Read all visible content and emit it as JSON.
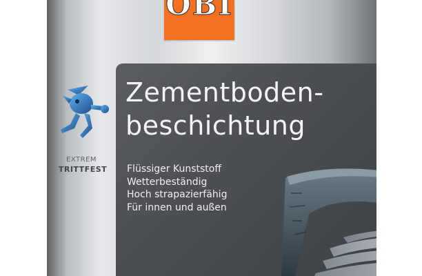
{
  "brand": {
    "logo_text": "OBI",
    "logo_color": "#f36f21"
  },
  "product": {
    "title_line1": "Zementboden-",
    "title_line2": "beschichtung",
    "features": [
      "Flüssiger Kunststoff",
      "Wetterbeständig",
      "Hoch strapazierfähig",
      "Für innen und außen"
    ]
  },
  "badge": {
    "line1": "EXTREM",
    "line2": "TRITTFEST",
    "icon": "running-figure-icon"
  },
  "colors": {
    "panel": "#4c5054",
    "can_silver": "#d4d7d9",
    "figure_blue": "#2f6fb0"
  }
}
